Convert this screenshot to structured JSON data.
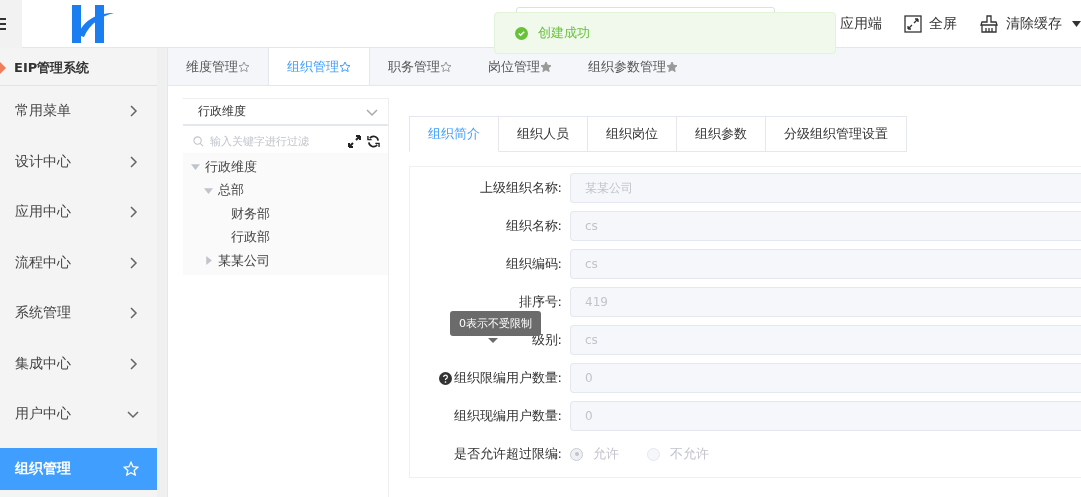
{
  "header": {
    "actions": [
      {
        "kind": "plain",
        "label": "应用端"
      },
      {
        "kind": "fullscreen",
        "label": "全屏"
      },
      {
        "kind": "broom",
        "label": "清除缓存"
      }
    ]
  },
  "toast": {
    "message": "创建成功"
  },
  "sidebar": {
    "title": "EIP管理系统",
    "items": [
      {
        "label": "常用菜单",
        "kind": "group",
        "expanded": false,
        "selected": false
      },
      {
        "label": "设计中心",
        "kind": "group",
        "expanded": false,
        "selected": false
      },
      {
        "label": "应用中心",
        "kind": "group",
        "expanded": false,
        "selected": false
      },
      {
        "label": "流程中心",
        "kind": "group",
        "expanded": false,
        "selected": false
      },
      {
        "label": "系统管理",
        "kind": "group",
        "expanded": false,
        "selected": false
      },
      {
        "label": "集成中心",
        "kind": "group",
        "expanded": false,
        "selected": false
      },
      {
        "label": "用户中心",
        "kind": "group",
        "expanded": true,
        "selected": false
      },
      {
        "label": "组织管理",
        "kind": "leaf",
        "selected": true
      }
    ]
  },
  "page_tabs": [
    {
      "label": "维度管理",
      "selected": false,
      "starred": false
    },
    {
      "label": "组织管理",
      "selected": true,
      "starred": false
    },
    {
      "label": "职务管理",
      "selected": false,
      "starred": false
    },
    {
      "label": "岗位管理",
      "selected": false,
      "starred": true
    },
    {
      "label": "组织参数管理",
      "selected": false,
      "starred": true
    }
  ],
  "tree_panel": {
    "dimension": "行政维度",
    "search": {
      "placeholder": "输入关键字进行过滤"
    },
    "tree": [
      {
        "label": "行政维度",
        "expanded": true,
        "children": [
          {
            "label": "总部",
            "expanded": true,
            "children": [
              {
                "label": "财务部"
              },
              {
                "label": "行政部"
              }
            ]
          },
          {
            "label": "某某公司",
            "expanded": false
          }
        ]
      }
    ]
  },
  "detail_tabs": [
    {
      "label": "组织简介",
      "selected": true
    },
    {
      "label": "组织人员",
      "selected": false
    },
    {
      "label": "组织岗位",
      "selected": false
    },
    {
      "label": "组织参数",
      "selected": false
    },
    {
      "label": "分级组织管理设置",
      "selected": false
    }
  ],
  "form": [
    {
      "kind": "input",
      "label": "上级组织名称:",
      "value": "某某公司"
    },
    {
      "kind": "input",
      "label": "组织名称:",
      "value": "cs"
    },
    {
      "kind": "input",
      "label": "组织编码:",
      "value": "cs"
    },
    {
      "kind": "input",
      "label": "排序号:",
      "value": "419"
    },
    {
      "kind": "input",
      "label": "级别:",
      "value": "cs"
    },
    {
      "kind": "input",
      "label": "组织限编用户数量:",
      "value": "0",
      "help": true
    },
    {
      "kind": "input",
      "label": "组织现编用户数量:",
      "value": "0"
    },
    {
      "kind": "radio",
      "label": "是否允许超过限编:",
      "options": [
        {
          "label": "允许",
          "selected": true
        },
        {
          "label": "不允许",
          "selected": false
        }
      ]
    }
  ],
  "tooltip": {
    "text": "0表示不受限制"
  }
}
